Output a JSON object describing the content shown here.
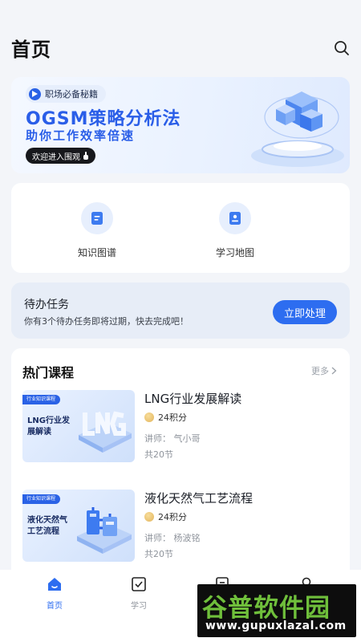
{
  "header": {
    "title": "首页",
    "search_icon": "search-icon"
  },
  "banner": {
    "tag": "职场必备秘籍",
    "title": "OGSM策略分析法",
    "subtitle": "助你工作效率倍速",
    "cta": "欢迎进入围观",
    "accent": "#2a5ee8"
  },
  "quick": [
    {
      "label": "知识图谱",
      "icon": "document-icon"
    },
    {
      "label": "学习地图",
      "icon": "badge-icon"
    }
  ],
  "todo": {
    "title": "待办任务",
    "desc": "你有3个待办任务即将过期，快去完成吧！",
    "button": "立即处理"
  },
  "courses": {
    "title": "热门课程",
    "more": "更多",
    "items": [
      {
        "thumb_tag": "行业知识课程",
        "thumb_title": "LNG行业发展解读",
        "name": "LNG行业发展解读",
        "points": "24积分",
        "teacher": "讲师：  气小哥",
        "lessons": "共20节"
      },
      {
        "thumb_tag": "行业知识课程",
        "thumb_title": "液化天然气工艺流程",
        "name": "液化天然气工艺流程",
        "points": "24积分",
        "teacher": "讲师：  杨波铭",
        "lessons": "共20节"
      }
    ]
  },
  "tabbar": [
    {
      "label": "首页",
      "icon": "home-icon",
      "active": true
    },
    {
      "label": "学习",
      "icon": "checkbox-icon",
      "active": false
    },
    {
      "label": "",
      "icon": "document-icon",
      "active": false
    },
    {
      "label": "",
      "icon": "user-icon",
      "active": false
    }
  ],
  "watermark": {
    "title": "谷普软件园",
    "url": "www.gupuxlazal.com"
  },
  "colors": {
    "primary": "#2d6df0",
    "background": "#f3f5f9"
  }
}
